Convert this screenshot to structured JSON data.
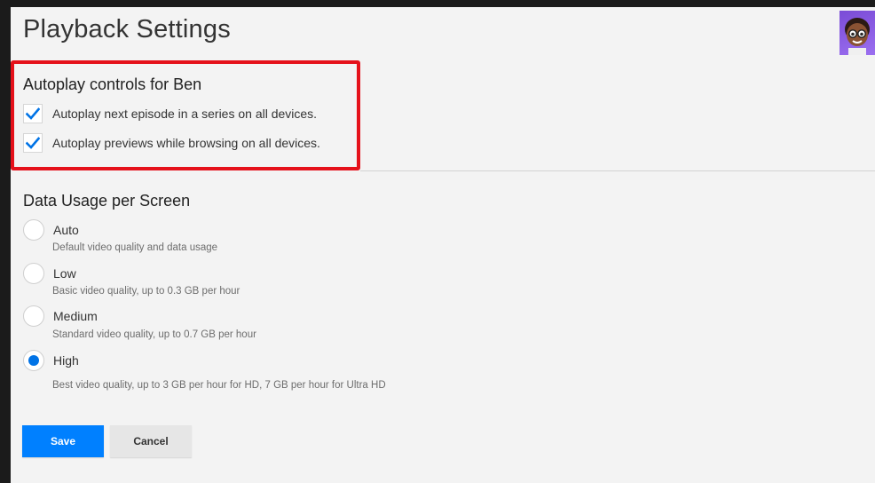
{
  "header": {
    "title": "Playback Settings"
  },
  "autoplay": {
    "title": "Autoplay controls for Ben",
    "options": [
      {
        "label": "Autoplay next episode in a series on all devices.",
        "checked": true
      },
      {
        "label": "Autoplay previews while browsing on all devices.",
        "checked": true
      }
    ]
  },
  "data_usage": {
    "title": "Data Usage per Screen",
    "selected": "High",
    "options": [
      {
        "label": "Auto",
        "description": "Default video quality and data usage"
      },
      {
        "label": "Low",
        "description": "Basic video quality, up to 0.3 GB per hour"
      },
      {
        "label": "Medium",
        "description": "Standard video quality, up to 0.7 GB per hour"
      },
      {
        "label": "High",
        "description": "Best video quality, up to 3 GB per hour for HD, 7 GB per hour for Ultra HD"
      }
    ]
  },
  "actions": {
    "save_label": "Save",
    "cancel_label": "Cancel"
  },
  "colors": {
    "accent": "#0080ff",
    "highlight": "#e5111a",
    "check": "#0073e6"
  },
  "icons": {
    "checkbox": "checkmark-icon",
    "avatar": "profile-avatar-icon"
  }
}
